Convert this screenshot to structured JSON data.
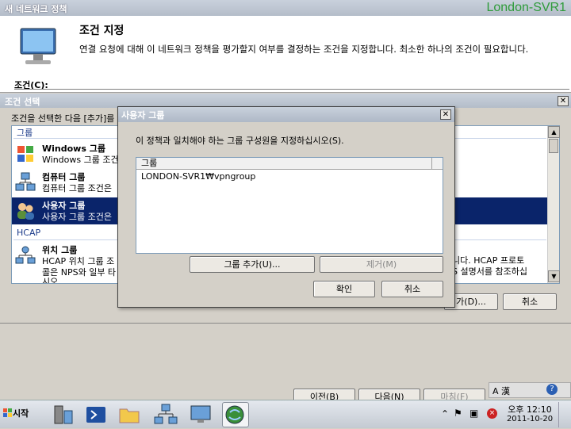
{
  "wizard": {
    "title": "새 네트워크 정책",
    "server_name": "London-SVR1",
    "heading": "조건 지정",
    "description": "연결 요청에 대해 이 네트워크 정책을 평가할지 여부를 결정하는 조건을 지정합니다. 최소한 하나의 조건이 필요합니다.",
    "conditions_label": "조건(C):",
    "nav": {
      "prev": "이전(B)",
      "next": "다음(N)",
      "finish": "마침(F)"
    }
  },
  "condition_select": {
    "title": "조건 선택",
    "instruction": "조건을 선택한 다음 [추가]를",
    "categories": [
      {
        "label": "그룹"
      },
      {
        "label": "HCAP"
      }
    ],
    "items": [
      {
        "name": "Windows 그룹",
        "desc": "Windows 그룹 조건",
        "icon": "windows-group-icon"
      },
      {
        "name": "컴퓨터 그룹",
        "desc": "컴퓨터 그룹 조건은",
        "icon": "computer-group-icon"
      },
      {
        "name": "사용자 그룹",
        "desc": "사용자 그룹 조건은",
        "icon": "user-group-icon",
        "selected": true
      },
      {
        "name": "위치 그룹",
        "desc": "HCAP 위치 그룹 조",
        "desc2": "콜은 NPS와 일부 타",
        "desc3": "시오.",
        "icon": "location-group-icon"
      }
    ],
    "right_text_1": "니다. HCAP 프로토",
    "right_text_2": "S 설명서를 참조하십",
    "add_button": "가(D)...",
    "close_button": "취소"
  },
  "user_group_dialog": {
    "title": "사용자 그룹",
    "instruction": "이 정책과 일치해야 하는 그룹 구성원을 지정하십시오(S).",
    "column_header": "그룹",
    "groups": [
      "LONDON-SVR1₩vpngroup"
    ],
    "add_button": "그룹 추가(U)...",
    "remove_button": "제거(M)",
    "ok_button": "확인",
    "cancel_button": "취소"
  },
  "taskbar": {
    "start_label": "시작",
    "clock_time": "오후 12:10",
    "clock_date": "2011-10-20",
    "lang_label": "A 漢"
  },
  "colors": {
    "selection": "#0a246a",
    "titlebar": "#b4bdc9",
    "server_name": "#2e9b3a"
  }
}
